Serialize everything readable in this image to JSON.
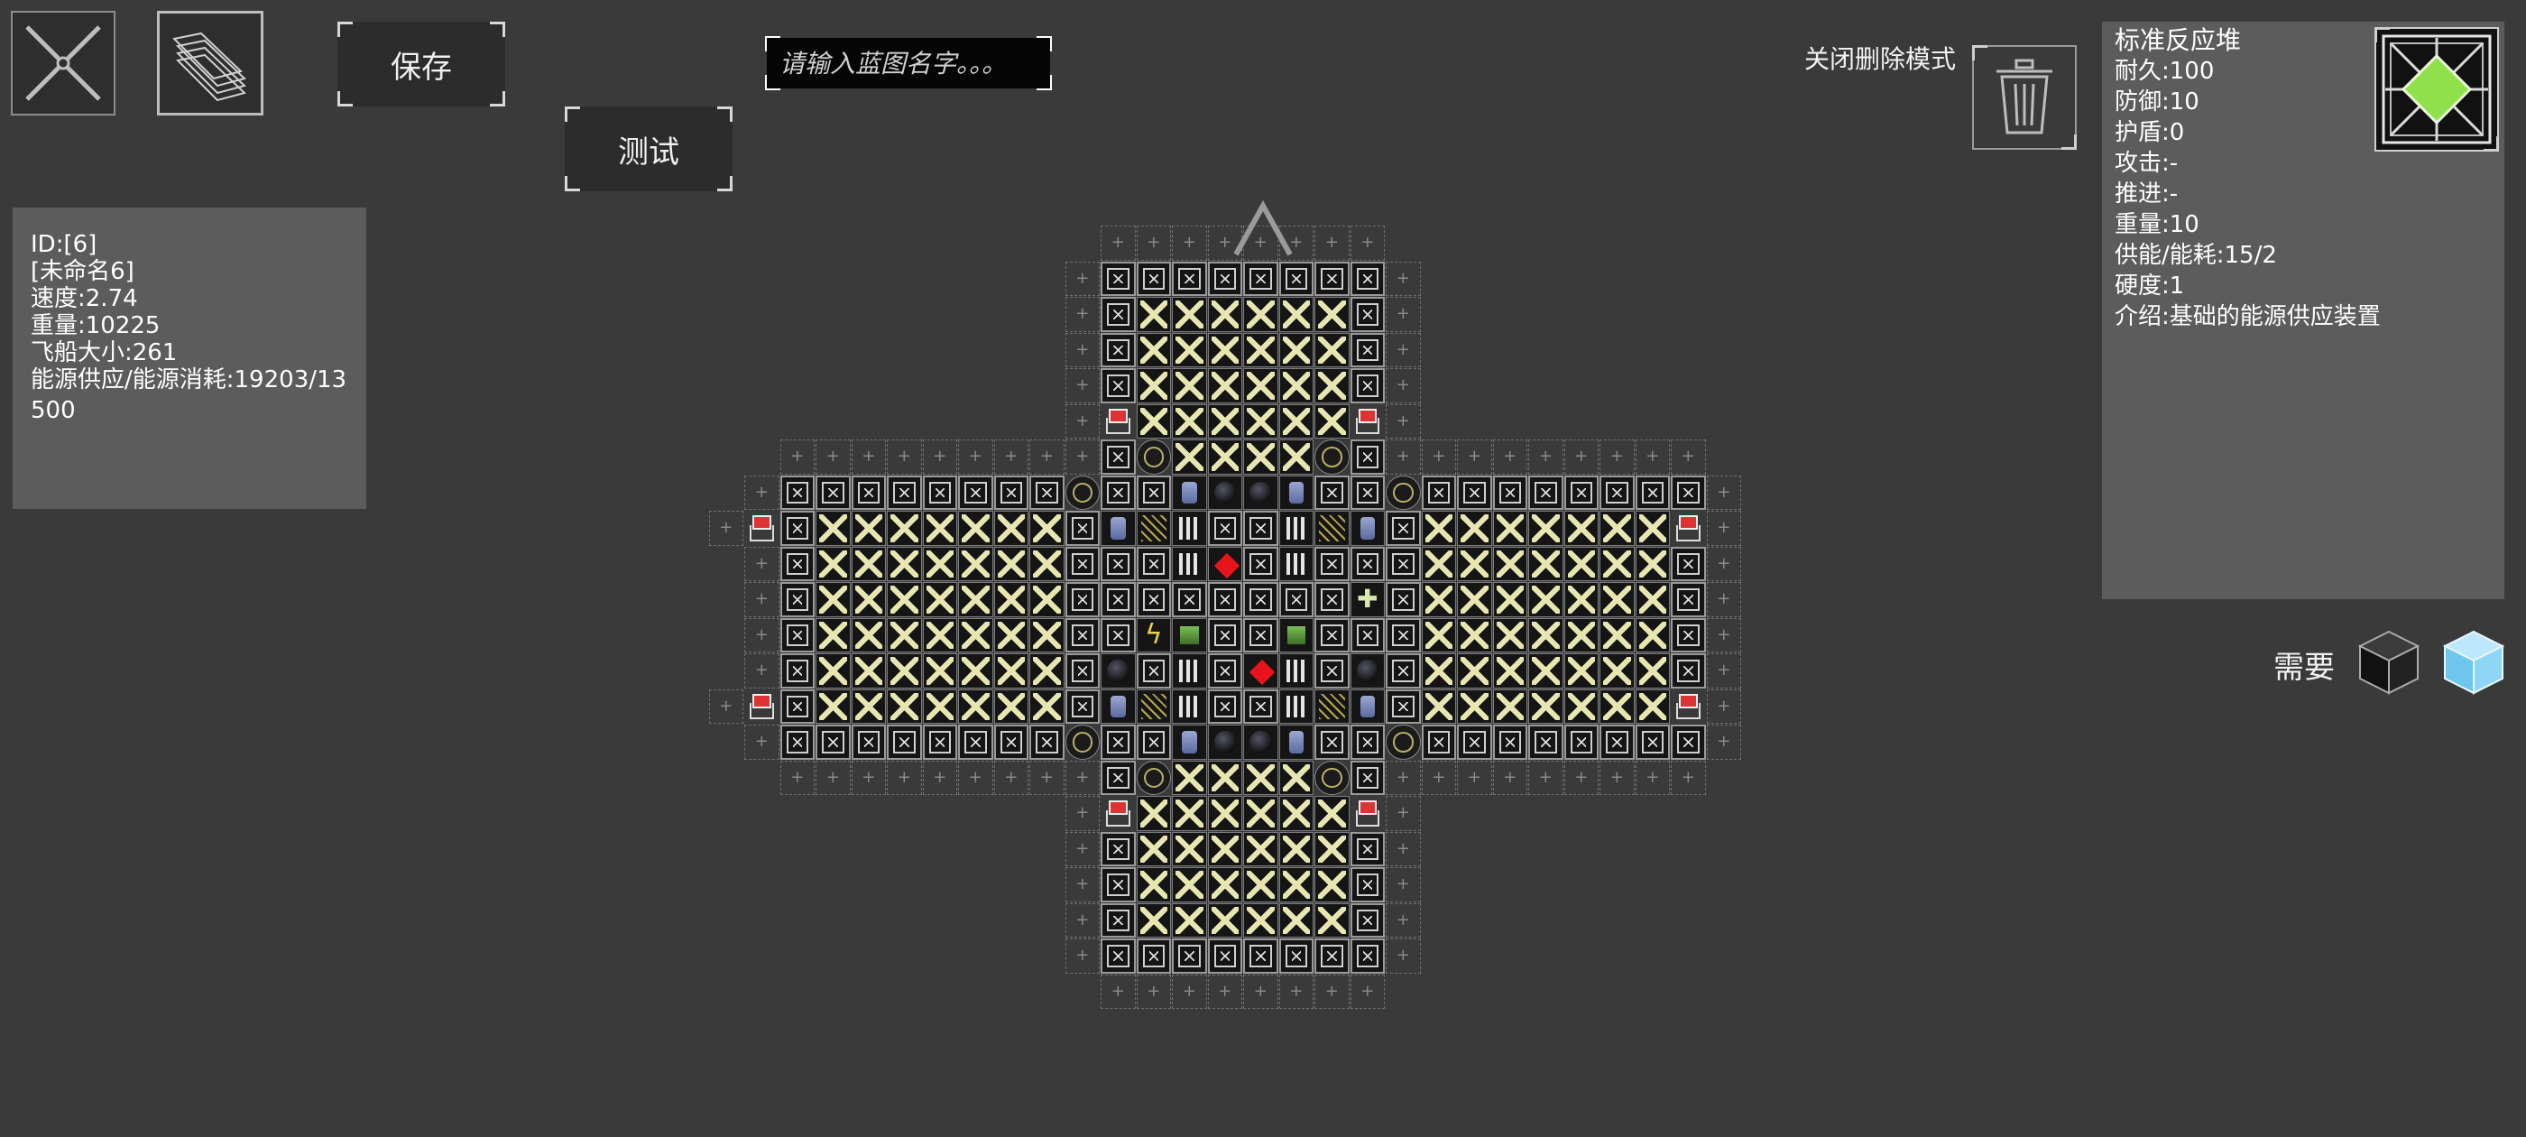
{
  "toolbar": {
    "close_icon": "close-x-icon",
    "layers_icon": "layers-icon",
    "save_label": "保存",
    "test_label": "测试",
    "name_placeholder": "请输入蓝图名字。。。"
  },
  "ship_stats": {
    "id": "ID:[6]",
    "name": "[未命名6]",
    "speed": "速度:2.74",
    "weight": "重量:10225",
    "size": "飞船大小:261",
    "energy": "能源供应/能源消耗:19203/13500"
  },
  "delete_mode": {
    "label": "关闭删除模式",
    "icon": "trash-icon"
  },
  "component": {
    "name": "标准反应堆",
    "durability": "耐久:100",
    "defense": "防御:10",
    "shield": "护盾:0",
    "attack": "攻击:-",
    "thrust": "推进:-",
    "weight": "重量:10",
    "power": "供能/能耗:15/2",
    "hardness": "硬度:1",
    "description": "介绍:基础的能源供应装置",
    "icon": "reactor-icon",
    "icon_color": "#8fe04a"
  },
  "requirements": {
    "label": "需要",
    "items": [
      "black-cube-icon",
      "ice-cube-icon"
    ]
  },
  "colors": {
    "background": "#3a3a3a",
    "panel": "#5c5c5c",
    "accent_red": "#e8141c"
  }
}
